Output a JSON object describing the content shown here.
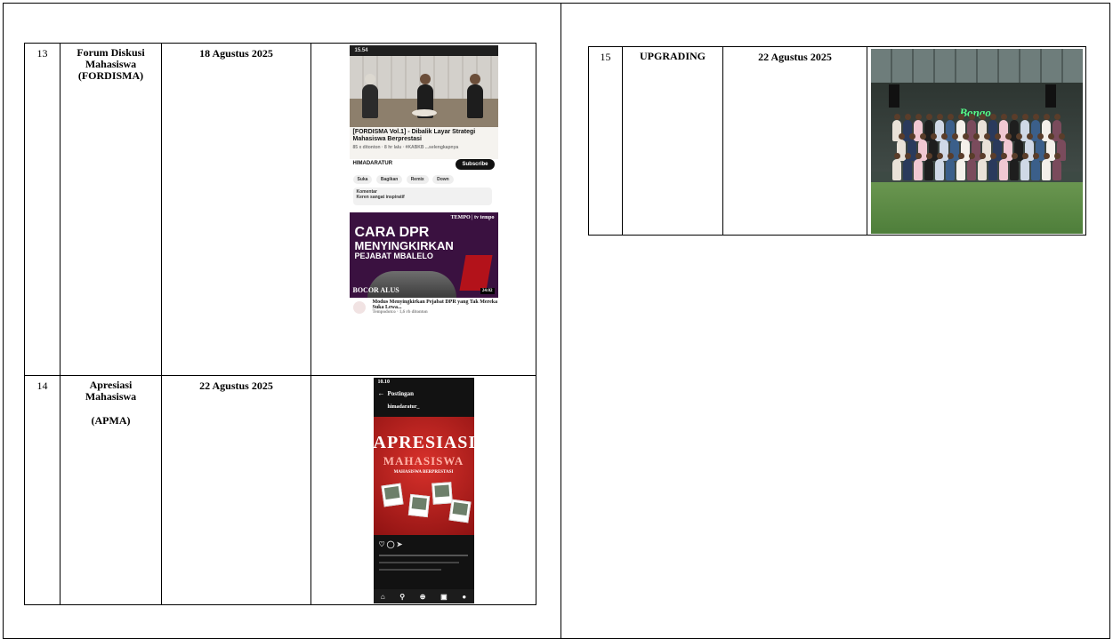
{
  "left_table": {
    "rows": [
      {
        "no": "13",
        "name_lines": [
          "Forum Diskusi",
          "Mahasiswa",
          "(FORDISMA)"
        ],
        "date": "18 Agustus 2025",
        "screenshot": {
          "status_time": "15.54",
          "video_title": "[FORDISMA Vol.1] - Dibalik Layar Strategi Mahasiswa Berprestasi",
          "video_meta": "85 x ditonton · 8 hr lalu · #KABKB ...selengkapnya",
          "channel": "HIMADARATUR",
          "subscribe_label": "Subscribe",
          "actions": [
            "Suka",
            "Bagikan",
            "Remix",
            "Down"
          ],
          "comments_label": "Komentar",
          "comment_text": "Keren sangat inspiratif",
          "news": {
            "brand": "TEMPO | tv tempo",
            "line1": "CARA DPR",
            "line2": "MENYINGKIRKAN",
            "line3": "PEJABAT MBALELO",
            "badge": "BOCOR ALUS",
            "duration": "24:02",
            "caption": "Modus Menyingkirkan Pejabat DPR yang Tak Mereka Suka Lewa...",
            "caption_meta": "Tempodotco · 1,6 rb ditonton"
          }
        }
      },
      {
        "no": "14",
        "name_lines": [
          "Apresiasi",
          "Mahasiswa",
          "",
          "(APMA)"
        ],
        "date": "22 Agustus 2025",
        "screenshot": {
          "status_time": "10.10",
          "header": "Postingan",
          "account": "himadaratur_",
          "poster_title": "APRESIASI",
          "poster_subtitle": "MAHASISWA",
          "poster_tagline": "MAHASISWA BERPRESTASI",
          "nav_icons": [
            "⌂",
            "⚲",
            "⊕",
            "▣",
            "●"
          ]
        }
      }
    ]
  },
  "right_table": {
    "rows": [
      {
        "no": "15",
        "name": "UPGRADING",
        "date": "22 Agustus 2025",
        "photo": {
          "neon_sign": "Bongo"
        }
      }
    ]
  }
}
